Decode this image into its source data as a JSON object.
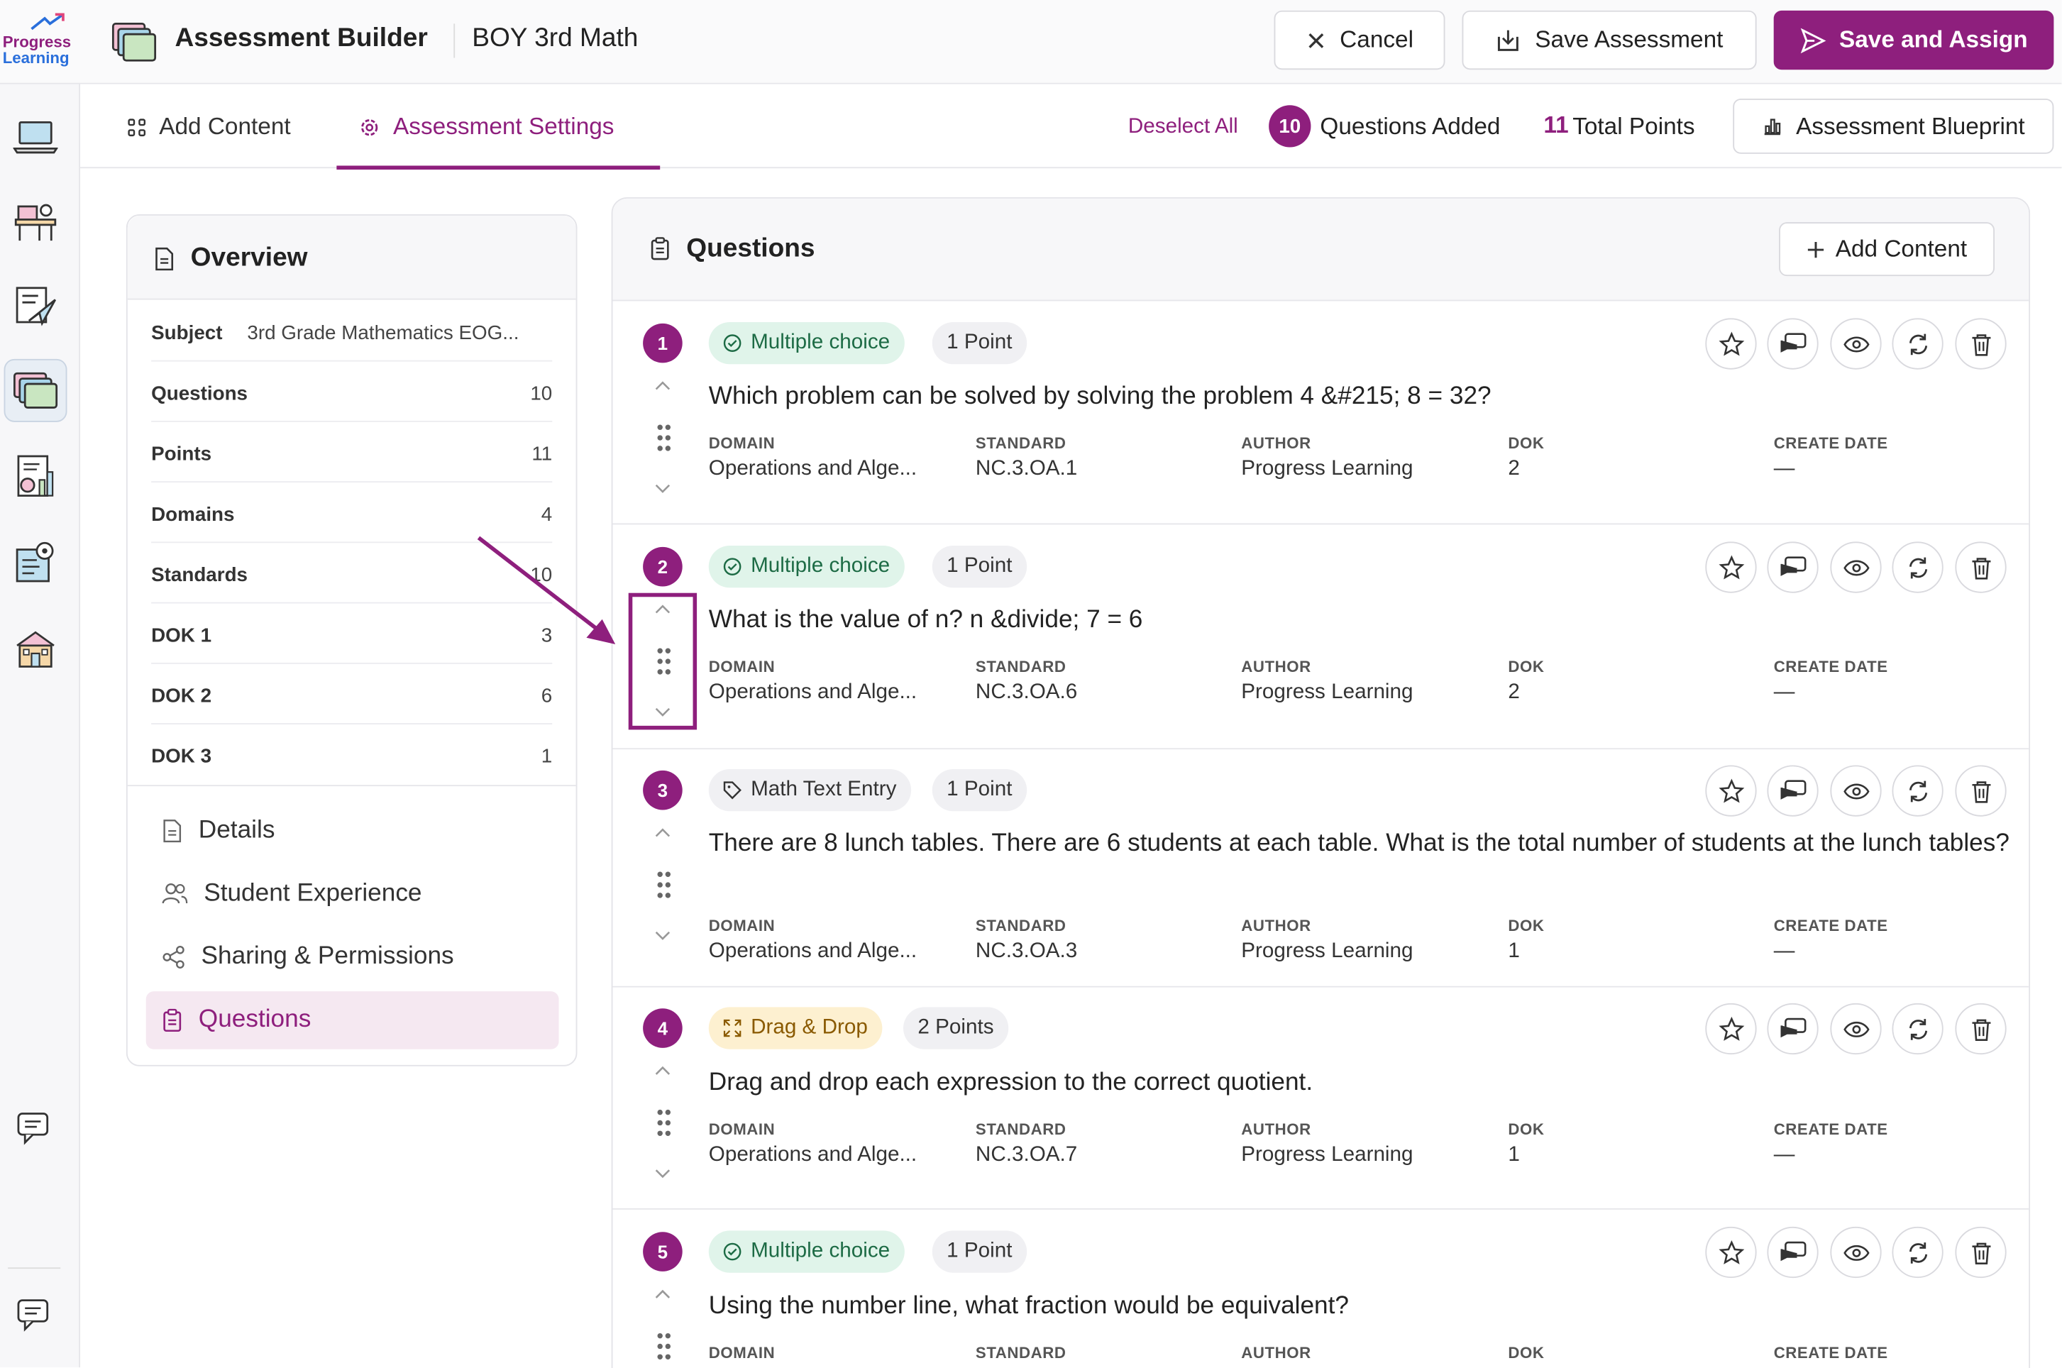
{
  "app": {
    "logo_line1": "Progress",
    "logo_line2": "Learning",
    "title": "Assessment Builder",
    "assessment_name": "BOY 3rd Math"
  },
  "header_buttons": {
    "cancel": "Cancel",
    "save": "Save Assessment",
    "assign": "Save and Assign"
  },
  "tabs": {
    "add_content": "Add Content",
    "settings": "Assessment Settings"
  },
  "summary": {
    "deselect": "Deselect All",
    "questions_count": "10",
    "questions_added": "Questions Added",
    "total_points_num": "11",
    "total_points_label": "Total Points",
    "blueprint": "Assessment Blueprint"
  },
  "overview": {
    "title": "Overview",
    "subject_label": "Subject",
    "subject_value": "3rd Grade Mathematics EOG...",
    "rows": [
      {
        "k": "Questions",
        "v": "10"
      },
      {
        "k": "Points",
        "v": "11"
      },
      {
        "k": "Domains",
        "v": "4"
      },
      {
        "k": "Standards",
        "v": "10"
      },
      {
        "k": "DOK 1",
        "v": "3"
      },
      {
        "k": "DOK 2",
        "v": "6"
      },
      {
        "k": "DOK 3",
        "v": "1"
      }
    ],
    "links": {
      "details": "Details",
      "student_experience": "Student Experience",
      "sharing": "Sharing & Permissions",
      "questions": "Questions"
    }
  },
  "questions_panel": {
    "title": "Questions",
    "add_content": "Add Content",
    "meta_labels": {
      "domain": "DOMAIN",
      "standard": "STANDARD",
      "author": "AUTHOR",
      "dok": "DOK",
      "create_date": "CREATE DATE"
    },
    "items": [
      {
        "num": "1",
        "type": "Multiple choice",
        "points": "1 Point",
        "text": "Which problem can be solved by solving the problem 4 &#215; 8 = 32?",
        "domain": "Operations and Alge...",
        "standard": "NC.3.OA.1",
        "author": "Progress Learning",
        "dok": "2",
        "date": "—"
      },
      {
        "num": "2",
        "type": "Multiple choice",
        "points": "1 Point",
        "text": "What is the value of n? n &divide; 7 = 6",
        "domain": "Operations and Alge...",
        "standard": "NC.3.OA.6",
        "author": "Progress Learning",
        "dok": "2",
        "date": "—"
      },
      {
        "num": "3",
        "type": "Math Text Entry",
        "points": "1 Point",
        "text": "There are 8 lunch tables. There are 6 students at each table. What is the total number of students at the lunch tables?",
        "domain": "Operations and Alge...",
        "standard": "NC.3.OA.3",
        "author": "Progress Learning",
        "dok": "1",
        "date": "—"
      },
      {
        "num": "4",
        "type": "Drag & Drop",
        "points": "2 Points",
        "text": "Drag and drop each expression to the correct quotient.",
        "domain": "Operations and Alge...",
        "standard": "NC.3.OA.7",
        "author": "Progress Learning",
        "dok": "1",
        "date": "—"
      },
      {
        "num": "5",
        "type": "Multiple choice",
        "points": "1 Point",
        "text": "Using the number line, what fraction would be equivalent?"
      }
    ]
  },
  "colors": {
    "brand": "#8e1f7d",
    "mc_badge_bg": "#e0f4ea",
    "dd_badge_bg": "#fdf0d0"
  },
  "icons": [
    "laptop-icon",
    "desk-icon",
    "send-icon",
    "folders-icon",
    "report-icon",
    "settings-clipboard-icon",
    "school-icon",
    "chat-icon",
    "star-icon",
    "feedback-icon",
    "eye-icon",
    "refresh-icon",
    "trash-icon",
    "grip-icon",
    "chevron-up-icon",
    "chevron-down-icon"
  ]
}
